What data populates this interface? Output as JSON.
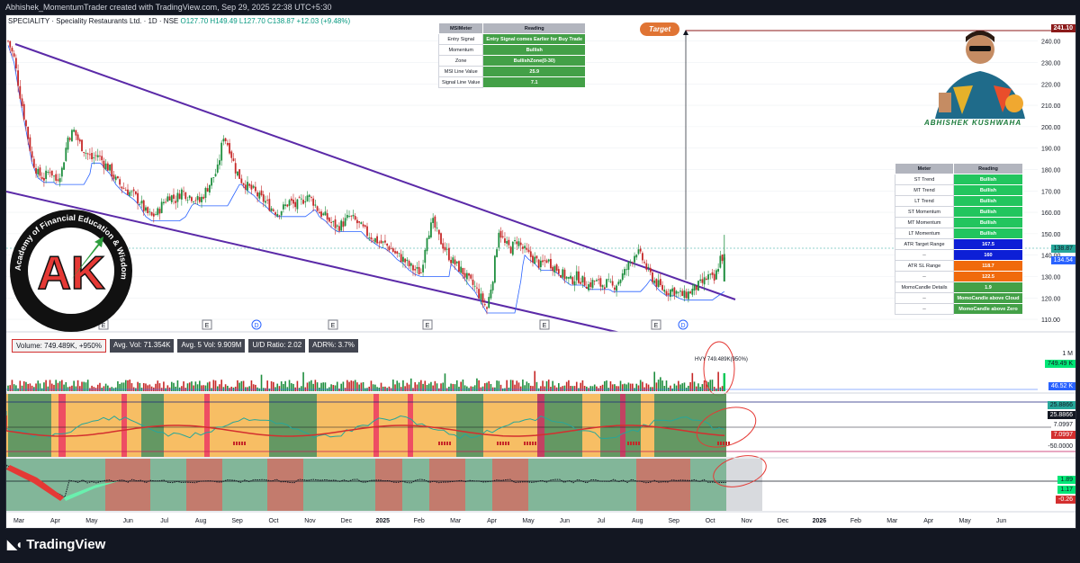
{
  "header": {
    "created_by": "Abhishek_MomentumTrader created with TradingView.com, Sep 29, 2025 22:38 UTC+5:30"
  },
  "ticker": {
    "name": "SPECIALITY · Speciality Restaurants Ltd. · 1D · NSE",
    "ohlc": "O127.70 H149.49 L127.70 C138.87",
    "change": "+12.03 (+9.48%)"
  },
  "msi_table": {
    "headers": [
      "MSIMeter",
      "Reading"
    ],
    "rows": [
      {
        "label": "Entry Signal",
        "value": "Entry Signal comes Earlier for Buy Trade",
        "color": "#43a047"
      },
      {
        "label": "Momentum",
        "value": "Bullish",
        "color": "#43a047"
      },
      {
        "label": "Zone",
        "value": "BullishZone(0-30)",
        "color": "#43a047"
      },
      {
        "label": "MSI Line Value",
        "value": "25.9",
        "color": "#43a047"
      },
      {
        "label": "Signal Line Value",
        "value": "7.1",
        "color": "#43a047"
      }
    ]
  },
  "meter_table": {
    "headers": [
      "Meter",
      "Reading"
    ],
    "rows": [
      {
        "label": "ST Trend",
        "value": "Bullish",
        "color": "#22c55e"
      },
      {
        "label": "MT Trend",
        "value": "Bullish",
        "color": "#22c55e"
      },
      {
        "label": "LT Trend",
        "value": "Bullish",
        "color": "#22c55e"
      },
      {
        "label": "ST Momentum",
        "value": "Bullish",
        "color": "#22c55e"
      },
      {
        "label": "MT Momentum",
        "value": "Bullish",
        "color": "#22c55e"
      },
      {
        "label": "LT Momentum",
        "value": "Bullish",
        "color": "#22c55e"
      },
      {
        "label": "ATR Target Range",
        "value": "167.5",
        "color": "#0d1fd6"
      },
      {
        "label": "--",
        "value": "160",
        "color": "#0d1fd6"
      },
      {
        "label": "ATR SL Range",
        "value": "118.7",
        "color": "#f06a0c"
      },
      {
        "label": "--",
        "value": "122.5",
        "color": "#f06a0c"
      },
      {
        "label": "MomoCandle Details",
        "value": "1.9",
        "color": "#43a047"
      },
      {
        "label": "--",
        "value": "MomoCandle above Cloud",
        "color": "#43a047"
      },
      {
        "label": "--",
        "value": "MomoCandle above Zero",
        "color": "#43a047"
      }
    ]
  },
  "target_label": "Target",
  "owner_caption": "ABHISHEK KUSHWAHA",
  "logo": {
    "initials": "AK",
    "ring_text": "Academy of Financial Education & Wisdom"
  },
  "volume_stats": {
    "volume": "Volume: 749.489K, +950%",
    "avg_vol": "Avg. Vol: 71.354K",
    "avg5_vol": "Avg. 5 Vol: 9.909M",
    "ud_ratio": "U/D Ratio: 2.02",
    "adr": "ADR%: 3.7%"
  },
  "hvy_label": "HVY 749.489K(950%)",
  "right_labels": {
    "target_price": "241.10",
    "last_price": "138.87",
    "blue_price": "134.54",
    "vol_1m": "1 M",
    "vol_last": "749.49 K",
    "vol_avg": "46.52 K",
    "msi_a": "25.8866",
    "msi_b": "25.8866",
    "sig_a": "7.0997",
    "sig_b": "7.0997",
    "lower_level": "-50.0000",
    "momo_a": "1.89",
    "momo_b": "1.17",
    "momo_c": "-0.26"
  },
  "event_markers": [
    "E",
    "E",
    "D",
    "E",
    "E",
    "E",
    "E",
    "D"
  ],
  "brand": "TradingView",
  "chart_data": {
    "type": "candlestick",
    "price_axis": {
      "ticks": [
        110,
        120,
        130,
        140,
        150,
        160,
        170,
        180,
        190,
        200,
        210,
        220,
        230,
        240
      ],
      "range": [
        105,
        247
      ]
    },
    "time_axis": [
      "Mar",
      "Apr",
      "May",
      "Jun",
      "Jul",
      "Aug",
      "Sep",
      "Oct",
      "Nov",
      "Dec",
      "2025",
      "Feb",
      "Mar",
      "Apr",
      "May",
      "Jun",
      "Jul",
      "Aug",
      "Sep",
      "Oct",
      "Nov",
      "Dec",
      "2026",
      "Feb",
      "Mar",
      "Apr",
      "May",
      "Jun"
    ],
    "close_path": [
      [
        0,
        240
      ],
      [
        3,
        232
      ],
      [
        6,
        215
      ],
      [
        9,
        200
      ],
      [
        12,
        185
      ],
      [
        15,
        178
      ],
      [
        18,
        176
      ],
      [
        21,
        180
      ],
      [
        24,
        175
      ],
      [
        27,
        180
      ],
      [
        30,
        195
      ],
      [
        33,
        198
      ],
      [
        36,
        192
      ],
      [
        39,
        188
      ],
      [
        42,
        185
      ],
      [
        45,
        187
      ],
      [
        48,
        183
      ],
      [
        51,
        180
      ],
      [
        54,
        175
      ],
      [
        57,
        172
      ],
      [
        60,
        170
      ],
      [
        63,
        168
      ],
      [
        66,
        165
      ],
      [
        69,
        160
      ],
      [
        72,
        158
      ],
      [
        75,
        160
      ],
      [
        78,
        165
      ],
      [
        81,
        168
      ],
      [
        84,
        166
      ],
      [
        87,
        170
      ],
      [
        90,
        168
      ],
      [
        93,
        167
      ],
      [
        96,
        165
      ],
      [
        99,
        170
      ],
      [
        102,
        175
      ],
      [
        105,
        180
      ],
      [
        108,
        196
      ],
      [
        111,
        190
      ],
      [
        114,
        180
      ],
      [
        117,
        175
      ],
      [
        120,
        172
      ],
      [
        123,
        170
      ],
      [
        126,
        167
      ],
      [
        129,
        165
      ],
      [
        132,
        162
      ],
      [
        135,
        160
      ],
      [
        138,
        162
      ],
      [
        141,
        165
      ],
      [
        144,
        163
      ],
      [
        147,
        165
      ],
      [
        150,
        168
      ],
      [
        153,
        165
      ],
      [
        156,
        160
      ],
      [
        159,
        158
      ],
      [
        162,
        155
      ],
      [
        165,
        153
      ],
      [
        168,
        155
      ],
      [
        171,
        158
      ],
      [
        174,
        156
      ],
      [
        177,
        153
      ],
      [
        180,
        150
      ],
      [
        183,
        148
      ],
      [
        186,
        146
      ],
      [
        189,
        145
      ],
      [
        192,
        143
      ],
      [
        195,
        140
      ],
      [
        198,
        138
      ],
      [
        201,
        135
      ],
      [
        204,
        133
      ],
      [
        207,
        132
      ],
      [
        210,
        150
      ],
      [
        213,
        155
      ],
      [
        216,
        148
      ],
      [
        219,
        143
      ],
      [
        222,
        138
      ],
      [
        225,
        135
      ],
      [
        228,
        132
      ],
      [
        231,
        128
      ],
      [
        234,
        125
      ],
      [
        237,
        120
      ],
      [
        240,
        115
      ],
      [
        243,
        130
      ],
      [
        246,
        152
      ],
      [
        249,
        145
      ],
      [
        252,
        143
      ],
      [
        255,
        147
      ],
      [
        258,
        143
      ],
      [
        261,
        140
      ],
      [
        264,
        138
      ],
      [
        267,
        135
      ],
      [
        270,
        138
      ],
      [
        273,
        135
      ],
      [
        276,
        133
      ],
      [
        279,
        130
      ],
      [
        282,
        128
      ],
      [
        285,
        130
      ],
      [
        288,
        128
      ],
      [
        291,
        126
      ],
      [
        294,
        128
      ],
      [
        297,
        126
      ],
      [
        300,
        127
      ],
      [
        303,
        125
      ],
      [
        306,
        128
      ],
      [
        309,
        132
      ],
      [
        312,
        137
      ],
      [
        315,
        142
      ],
      [
        318,
        138
      ],
      [
        321,
        132
      ],
      [
        324,
        128
      ],
      [
        327,
        125
      ],
      [
        330,
        123
      ],
      [
        333,
        124
      ],
      [
        336,
        122
      ],
      [
        339,
        121
      ],
      [
        342,
        123
      ],
      [
        345,
        125
      ],
      [
        348,
        127
      ],
      [
        351,
        130
      ],
      [
        354,
        128
      ],
      [
        357,
        138.87
      ]
    ],
    "total_bars": 360,
    "volume": {
      "last": 749489,
      "avg": 71354
    },
    "msi_oscillator": {
      "msi": 25.8866,
      "signal": 7.0997,
      "levels": [
        -50
      ]
    },
    "momo_oscillator": {
      "values": [
        1.89,
        1.17,
        -0.26
      ]
    },
    "target_price": 241.1,
    "last_price": 138.87
  }
}
